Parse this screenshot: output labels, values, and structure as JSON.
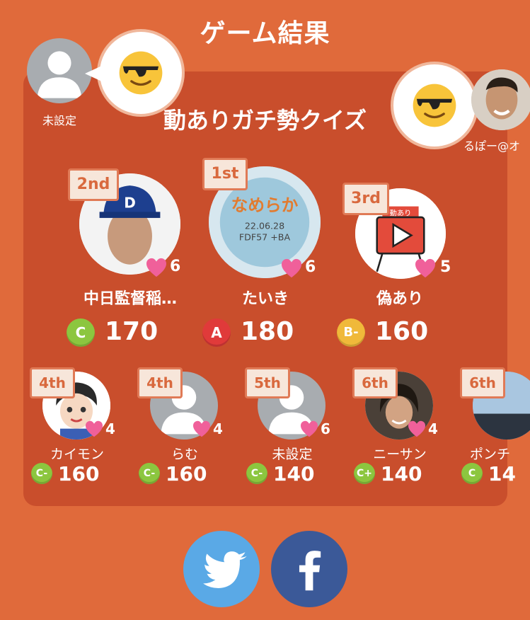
{
  "header": {
    "title": "ゲーム結果"
  },
  "quiz": {
    "title": "動ありガチ勢クイズ"
  },
  "left_player": {
    "name": "未設定",
    "reaction": "sunglasses-emoji"
  },
  "right_player": {
    "name": "るぽー@オ",
    "reaction": "sunglasses-emoji"
  },
  "podium": [
    {
      "rank": "2nd",
      "name": "中日監督稲…",
      "hearts": "6",
      "grade": "C",
      "grade_color": "#8cc63f",
      "score": "170"
    },
    {
      "rank": "1st",
      "name": "たいき",
      "hearts": "6",
      "grade": "A",
      "grade_color": "#e03a3a",
      "score": "180"
    },
    {
      "rank": "3rd",
      "name": "偽あり",
      "hearts": "5",
      "grade": "B-",
      "grade_color": "#f0b93a",
      "score": "160"
    }
  ],
  "others": [
    {
      "rank": "4th",
      "name": "カイモン",
      "hearts": "4",
      "grade": "C-",
      "score": "160"
    },
    {
      "rank": "4th",
      "name": "らむ",
      "hearts": "4",
      "grade": "C-",
      "score": "160"
    },
    {
      "rank": "5th",
      "name": "未設定",
      "hearts": "6",
      "grade": "C-",
      "score": "140"
    },
    {
      "rank": "6th",
      "name": "ニーサン",
      "hearts": "4",
      "grade": "C+",
      "score": "140"
    },
    {
      "rank": "6th",
      "name": "ポンチ",
      "hearts": "",
      "grade": "C",
      "score": "14"
    }
  ],
  "colors": {
    "background": "#e06a3b",
    "panel": "#c94e2c",
    "heart": "#f0609a",
    "twitter": "#5aa9e6",
    "facebook": "#3b5998"
  },
  "icons": {
    "twitter": "twitter-bird-icon",
    "facebook": "facebook-f-icon"
  }
}
